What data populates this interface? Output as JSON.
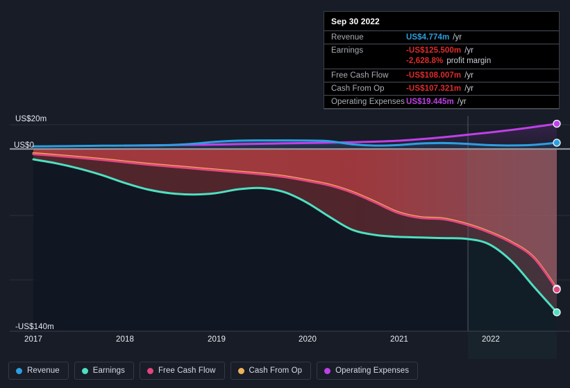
{
  "colors": {
    "background": "#171c26",
    "revenue": "#2d9fe0",
    "earnings": "#4ee0c1",
    "free_cash_flow": "#e0467c",
    "cash_from_op": "#eeb25a",
    "operating_expenses": "#c040e8",
    "negative_area": "#a83b3f",
    "zero_line": "#9aa1ab",
    "gridline": "#2b313c",
    "tooltip_value_positive": "#2d9fe0",
    "tooltip_value_negative": "#e02b2b",
    "tooltip_value_opex": "#c040e8"
  },
  "y_axis": {
    "labels": [
      {
        "text": "US$20m",
        "value": 20,
        "y": 166
      },
      {
        "text": "US$0",
        "value": 0,
        "y": 204
      },
      {
        "text": "-US$140m",
        "value": -140,
        "y": 466
      }
    ],
    "gridlines_y": [
      180,
      215,
      311,
      404,
      478
    ],
    "zero_y": 215,
    "min": -140,
    "max": 20
  },
  "x_axis": {
    "labels": [
      "2017",
      "2018",
      "2019",
      "2020",
      "2021",
      "2022"
    ],
    "positions": [
      48,
      180,
      312,
      443,
      575,
      707
    ]
  },
  "tooltip": {
    "date": "Sep 30 2022",
    "rows": [
      {
        "label": "Revenue",
        "value": "US$4.774m",
        "unit": "/yr",
        "color_key": "tooltip_value_positive"
      },
      {
        "label": "Earnings",
        "value": "-US$125.500m",
        "unit": "/yr",
        "color_key": "tooltip_value_negative"
      },
      {
        "label": "",
        "value": "-2,628.8%",
        "unit": "profit margin",
        "color_key": "tooltip_value_negative"
      },
      {
        "label": "Free Cash Flow",
        "value": "-US$108.007m",
        "unit": "/yr",
        "color_key": "tooltip_value_negative"
      },
      {
        "label": "Cash From Op",
        "value": "-US$107.321m",
        "unit": "/yr",
        "color_key": "tooltip_value_negative"
      },
      {
        "label": "Operating Expenses",
        "value": "US$19.445m",
        "unit": "/yr",
        "color_key": "tooltip_value_opex"
      }
    ]
  },
  "legend": {
    "items": [
      {
        "label": "Revenue",
        "color_key": "revenue"
      },
      {
        "label": "Earnings",
        "color_key": "earnings"
      },
      {
        "label": "Free Cash Flow",
        "color_key": "free_cash_flow"
      },
      {
        "label": "Cash From Op",
        "color_key": "cash_from_op"
      },
      {
        "label": "Operating Expenses",
        "color_key": "operating_expenses"
      }
    ]
  },
  "crosshair_x": 674,
  "chart_data": {
    "type": "line",
    "title": "",
    "xlabel": "",
    "ylabel": "",
    "ylim": [
      -140,
      20
    ],
    "grid": true,
    "legend_position": "bottom",
    "x": [
      "2017.00",
      "2017.25",
      "2017.50",
      "2017.75",
      "2018.00",
      "2018.25",
      "2018.50",
      "2018.75",
      "2019.00",
      "2019.25",
      "2019.50",
      "2019.75",
      "2020.00",
      "2020.25",
      "2020.50",
      "2020.75",
      "2021.00",
      "2021.25",
      "2021.50",
      "2021.75",
      "2022.00",
      "2022.25",
      "2022.50",
      "2022.75"
    ],
    "series": [
      {
        "name": "Revenue",
        "color": "#2d9fe0",
        "values": [
          2.0,
          2.1,
          2.3,
          2.5,
          2.6,
          2.7,
          3.0,
          4.0,
          5.5,
          6.4,
          6.6,
          6.6,
          6.5,
          6.0,
          3.6,
          2.6,
          3.0,
          4.2,
          4.6,
          4.0,
          3.0,
          2.7,
          3.2,
          4.8
        ]
      },
      {
        "name": "Earnings",
        "color": "#4ee0c1",
        "values": [
          -8.0,
          -11.0,
          -15.0,
          -20.0,
          -26.0,
          -31.0,
          -34.0,
          -35.0,
          -34.0,
          -31.0,
          -30.0,
          -33.0,
          -41.0,
          -52.0,
          -62.0,
          -66.0,
          -67.5,
          -68.0,
          -68.5,
          -69.0,
          -73.0,
          -86.0,
          -106.0,
          -125.5
        ]
      },
      {
        "name": "Free Cash Flow",
        "color": "#e0467c",
        "values": [
          -4.0,
          -5.3,
          -6.8,
          -8.4,
          -10.2,
          -12.0,
          -13.5,
          -15.0,
          -16.5,
          -18.0,
          -19.5,
          -21.5,
          -24.5,
          -28.0,
          -33.5,
          -41.0,
          -49.0,
          -53.0,
          -54.0,
          -58.0,
          -64.0,
          -72.0,
          -84.0,
          -108.0
        ]
      },
      {
        "name": "Cash From Op",
        "color": "#eeb25a",
        "values": [
          -3.3,
          -4.7,
          -6.2,
          -7.8,
          -9.6,
          -11.4,
          -12.9,
          -14.4,
          -15.9,
          -17.4,
          -18.9,
          -20.9,
          -23.9,
          -27.4,
          -32.9,
          -40.4,
          -48.4,
          -52.4,
          -53.4,
          -57.4,
          -63.4,
          -71.4,
          -83.4,
          -107.3
        ]
      },
      {
        "name": "Operating Expenses",
        "color": "#c040e8",
        "values": [
          null,
          null,
          null,
          null,
          2.6,
          2.8,
          3.0,
          3.2,
          3.4,
          3.7,
          4.0,
          4.3,
          4.6,
          4.9,
          5.2,
          5.6,
          6.3,
          7.5,
          9.0,
          10.8,
          12.6,
          14.6,
          16.9,
          19.4
        ]
      }
    ]
  }
}
